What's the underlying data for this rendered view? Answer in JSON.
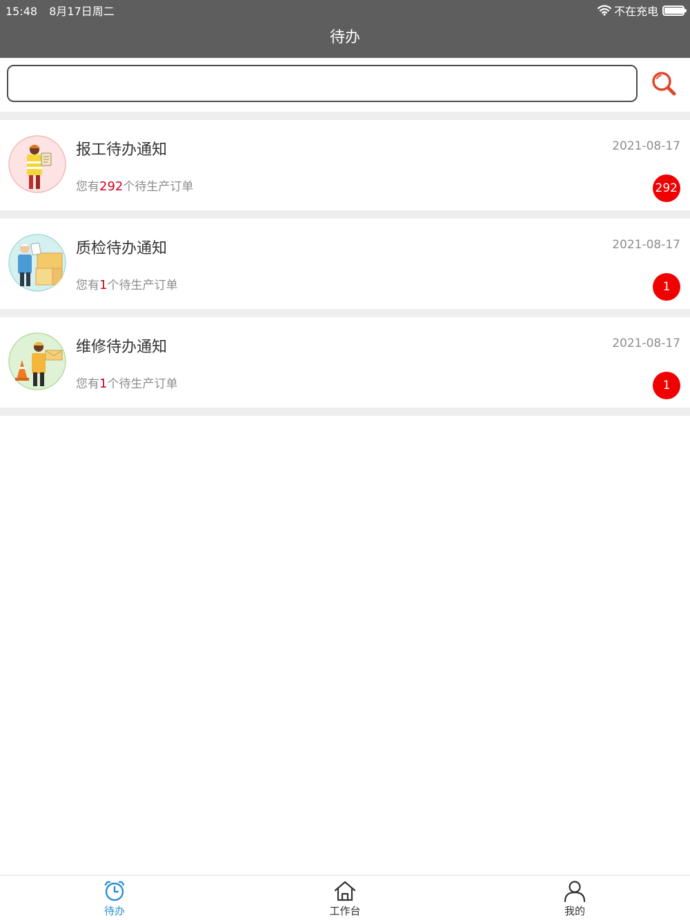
{
  "status_bar": {
    "time": "15:48",
    "date": "8月17日周二",
    "charging": "不在充电",
    "battery_level": 0.95,
    "icons": [
      "wifi-icon",
      "battery-icon"
    ]
  },
  "nav": {
    "title": "待办"
  },
  "search": {
    "value": "",
    "placeholder": "",
    "icon": "search-icon"
  },
  "items": [
    {
      "title": "报工待办通知",
      "prefix": "您有",
      "count": "292",
      "suffix": "个待生产订单",
      "date": "2021-08-17",
      "badge": "292",
      "avatar_icon": "worker-clipboard-icon",
      "avatar_bg": "#fde3e3"
    },
    {
      "title": "质检待办通知",
      "prefix": "您有",
      "count": "1",
      "suffix": "个待生产订单",
      "date": "2021-08-17",
      "badge": "1",
      "avatar_icon": "inspector-boxes-icon",
      "avatar_bg": "#d4f0ef"
    },
    {
      "title": "维修待办通知",
      "prefix": "您有",
      "count": "1",
      "suffix": "个待生产订单",
      "date": "2021-08-17",
      "badge": "1",
      "avatar_icon": "repair-worker-icon",
      "avatar_bg": "#dff2d6"
    }
  ],
  "tabs": [
    {
      "label": "待办",
      "icon": "alarm-clock-icon",
      "active": true
    },
    {
      "label": "工作台",
      "icon": "home-icon",
      "active": false
    },
    {
      "label": "我的",
      "icon": "person-icon",
      "active": false
    }
  ],
  "colors": {
    "bar": "#5e5e5e",
    "accent": "#2a8fd8",
    "badge": "#f00000",
    "highlight": "#d0021b",
    "search_icon": "#e0472a"
  }
}
